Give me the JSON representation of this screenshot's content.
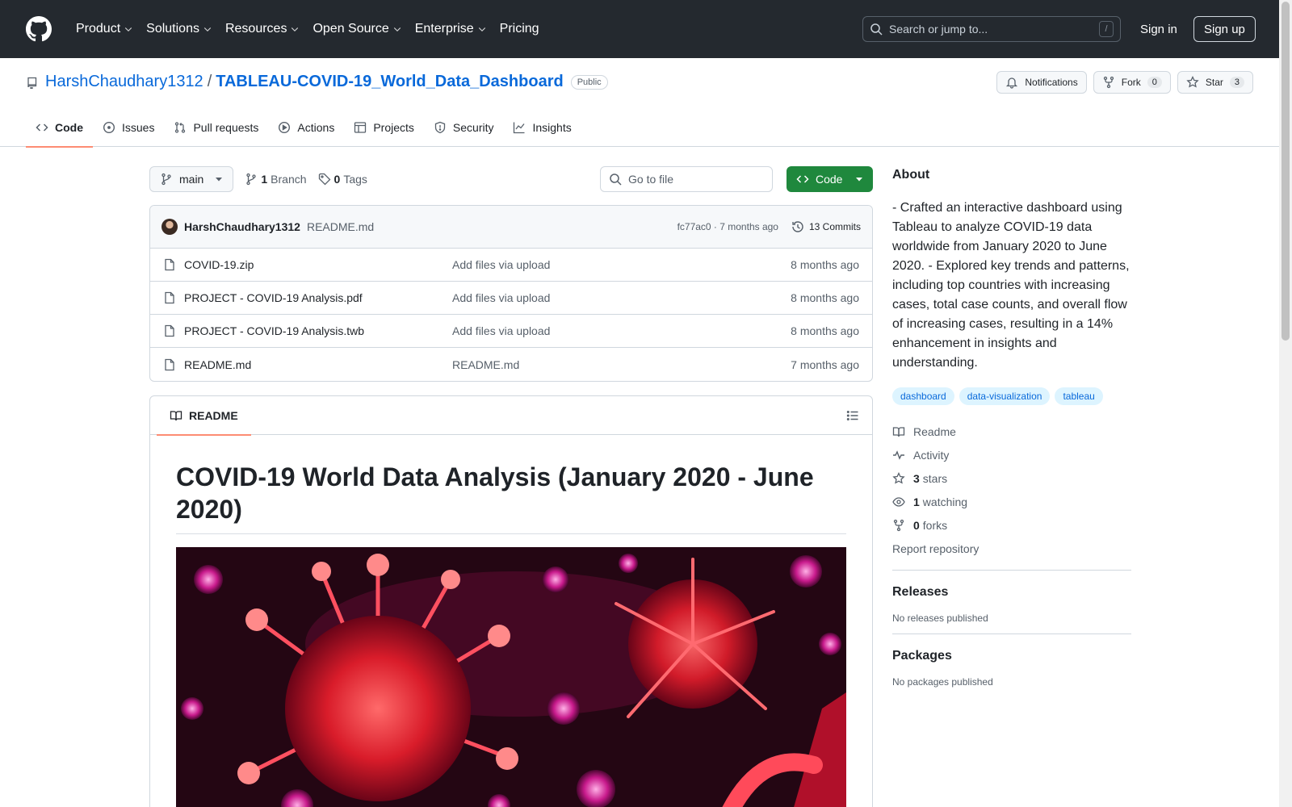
{
  "header": {
    "nav": [
      "Product",
      "Solutions",
      "Resources",
      "Open Source",
      "Enterprise",
      "Pricing"
    ],
    "search_placeholder": "Search or jump to...",
    "search_key": "/",
    "sign_in": "Sign in",
    "sign_up": "Sign up"
  },
  "repo": {
    "owner": "HarshChaudhary1312",
    "separator": "/",
    "name": "TABLEAU-COVID-19_World_Data_Dashboard",
    "visibility": "Public",
    "notifications": "Notifications",
    "fork_label": "Fork",
    "fork_count": "0",
    "star_label": "Star",
    "star_count": "3"
  },
  "tabs": [
    {
      "label": "Code",
      "icon": "code-icon"
    },
    {
      "label": "Issues",
      "icon": "issue-icon"
    },
    {
      "label": "Pull requests",
      "icon": "pull-request-icon"
    },
    {
      "label": "Actions",
      "icon": "play-icon"
    },
    {
      "label": "Projects",
      "icon": "table-icon"
    },
    {
      "label": "Security",
      "icon": "shield-icon"
    },
    {
      "label": "Insights",
      "icon": "graph-icon"
    }
  ],
  "toolbar": {
    "branch": "main",
    "branch_count": "1",
    "branch_label": "Branch",
    "tag_count": "0",
    "tag_label": "Tags",
    "goto_placeholder": "Go to file",
    "code_button": "Code"
  },
  "commit": {
    "author": "HarshChaudhary1312",
    "message": "README.md",
    "hash_time": "fc77ac0 · 7 months ago",
    "commits": "13 Commits"
  },
  "files": [
    {
      "name": "COVID-19.zip",
      "message": "Add files via upload",
      "time": "8 months ago"
    },
    {
      "name": "PROJECT - COVID-19 Analysis.pdf",
      "message": "Add files via upload",
      "time": "8 months ago"
    },
    {
      "name": "PROJECT - COVID-19 Analysis.twb",
      "message": "Add files via upload",
      "time": "8 months ago"
    },
    {
      "name": "README.md",
      "message": "README.md",
      "time": "7 months ago"
    }
  ],
  "readme": {
    "tab": "README",
    "title": "COVID-19 World Data Analysis (January 2020 - June 2020)"
  },
  "about": {
    "heading": "About",
    "description": "- Crafted an interactive dashboard using Tableau to analyze COVID-19 data worldwide from January 2020 to June 2020. - Explored key trends and patterns, including top countries with increasing cases, total case counts, and overall flow of increasing cases, resulting in a 14% enhancement in insights and understanding.",
    "topics": [
      "dashboard",
      "data-visualization",
      "tableau"
    ],
    "readme": "Readme",
    "activity": "Activity",
    "stars_count": "3",
    "stars_label": "stars",
    "watching_count": "1",
    "watching_label": "watching",
    "forks_count": "0",
    "forks_label": "forks",
    "report": "Report repository"
  },
  "releases": {
    "heading": "Releases",
    "note": "No releases published"
  },
  "packages": {
    "heading": "Packages",
    "note": "No packages published"
  },
  "colors": {
    "accent": "#0969da",
    "header_bg": "#24292f",
    "code_green": "#1f883d",
    "tab_underline": "#fd8c73"
  }
}
